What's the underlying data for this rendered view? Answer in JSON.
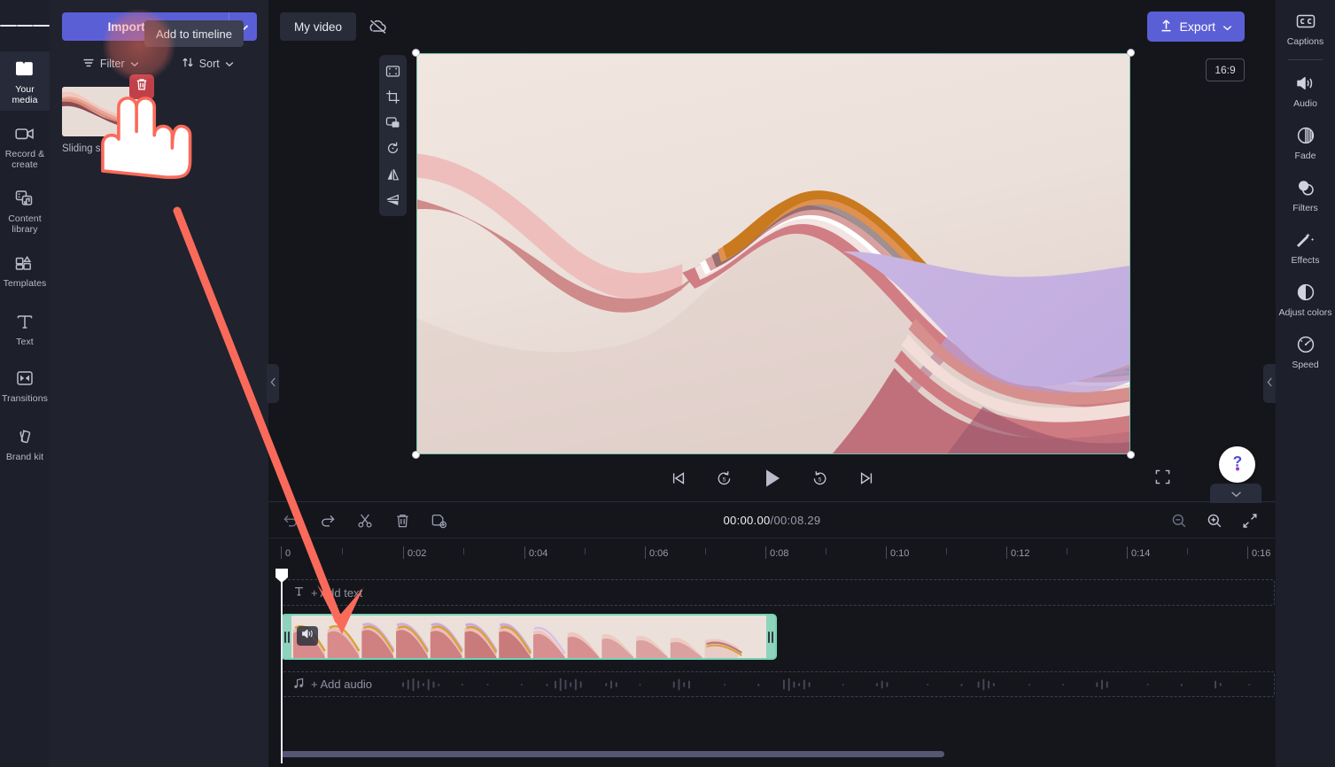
{
  "brand": {
    "accent": "#5b5fd6",
    "clip_accent": "#74d2b3",
    "annotation": "#fa6a5a"
  },
  "left_rail": {
    "menu_label": "menu",
    "items": [
      {
        "label": "Your media",
        "icon": "folder-icon",
        "active": true
      },
      {
        "label": "Record & create",
        "icon": "camera-icon",
        "active": false
      },
      {
        "label": "Content library",
        "icon": "library-icon",
        "active": false
      },
      {
        "label": "Templates",
        "icon": "templates-icon",
        "active": false
      },
      {
        "label": "Text",
        "icon": "text-icon",
        "active": false
      },
      {
        "label": "Transitions",
        "icon": "transitions-icon",
        "active": false
      },
      {
        "label": "Brand kit",
        "icon": "brandkit-icon",
        "active": false
      }
    ]
  },
  "media_panel": {
    "import_label": "Import media",
    "import_caret_icon": "chevron-down-icon",
    "filter_label": "Filter",
    "sort_label": "Sort",
    "items": [
      {
        "name": "Sliding sheets...",
        "delete_icon": "trash-icon",
        "add_icon": "plus-icon"
      }
    ],
    "tooltip": "Add to timeline"
  },
  "topbar": {
    "project_tab": "My video",
    "cloud_icon": "cloud-off-icon",
    "export_label": "Export",
    "export_icon": "upload-icon",
    "export_caret_icon": "chevron-down-icon"
  },
  "right_rail": {
    "items": [
      {
        "label": "Captions",
        "icon": "captions-icon"
      },
      {
        "label": "Audio",
        "icon": "speaker-icon"
      },
      {
        "label": "Fade",
        "icon": "fade-icon"
      },
      {
        "label": "Filters",
        "icon": "filters-icon"
      },
      {
        "label": "Effects",
        "icon": "effects-wand-icon"
      },
      {
        "label": "Adjust colors",
        "icon": "contrast-icon"
      },
      {
        "label": "Speed",
        "icon": "speedometer-icon"
      }
    ]
  },
  "stage": {
    "aspect_ratio": "16:9",
    "float_tools": [
      {
        "icon": "fit-icon"
      },
      {
        "icon": "crop-icon"
      },
      {
        "icon": "picture-in-picture-icon"
      },
      {
        "icon": "rotate-icon"
      },
      {
        "icon": "flip-horizontal-icon"
      },
      {
        "icon": "flip-vertical-icon"
      }
    ],
    "playback": [
      {
        "icon": "skip-back-icon"
      },
      {
        "icon": "rewind-5-icon",
        "label": "5"
      },
      {
        "icon": "play-icon"
      },
      {
        "icon": "forward-5-icon",
        "label": "5"
      },
      {
        "icon": "skip-forward-icon"
      }
    ],
    "fullscreen_icon": "fullscreen-icon",
    "collapse_left_icon": "chevron-left-icon",
    "collapse_right_icon": "chevron-left-icon",
    "help_icon": "question-mark-icon",
    "help_tab_icon": "chevron-down-icon"
  },
  "timeline": {
    "tools": [
      {
        "icon": "undo-icon"
      },
      {
        "icon": "redo-icon"
      },
      {
        "icon": "split-scissors-icon"
      },
      {
        "icon": "delete-trash-icon"
      },
      {
        "icon": "duplicate-icon"
      }
    ],
    "current_time": "00:00.00",
    "separator": " / ",
    "total_time": "00:08.29",
    "zoom_out_icon": "zoom-out-icon",
    "zoom_in_icon": "zoom-in-icon",
    "fit_timeline_icon": "fit-timeline-icon",
    "ruler_labels": [
      "0",
      "0:02",
      "0:04",
      "0:06",
      "0:08",
      "0:10",
      "0:12",
      "0:14",
      "0:16"
    ],
    "text_track_label": "+ Add text",
    "text_track_icon": "text-T-icon",
    "audio_track_label": "+ Add audio",
    "audio_track_icon": "music-note-icon",
    "clip": {
      "mute_icon": "speaker-icon",
      "handle_icon": "drag-handle-icon"
    }
  }
}
